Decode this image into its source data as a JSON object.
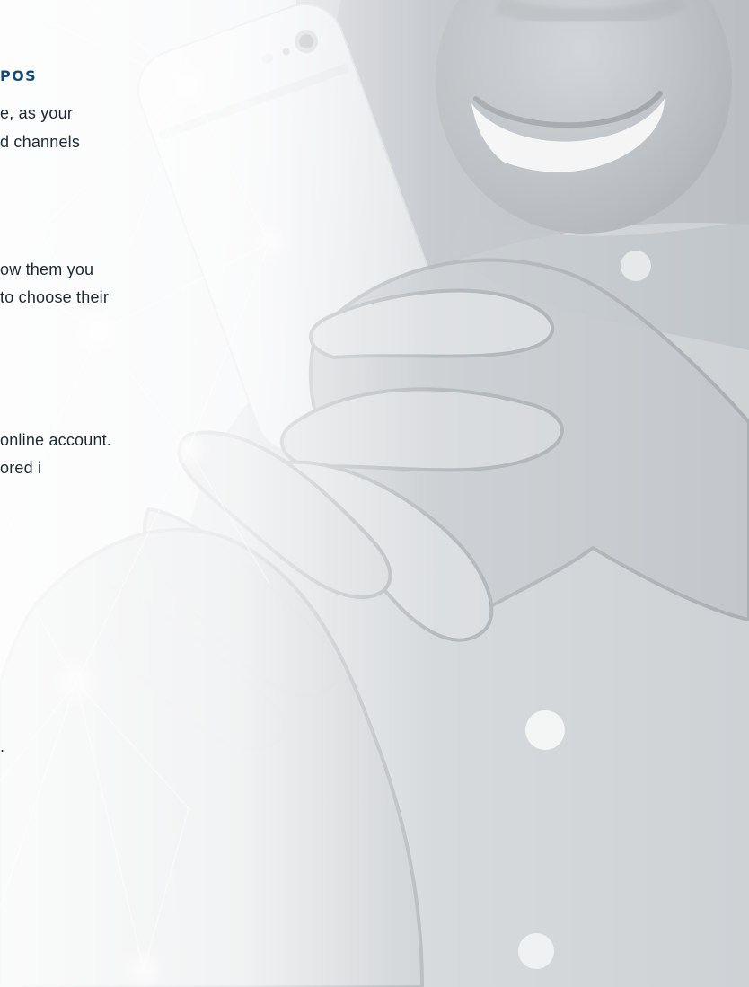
{
  "heading": "POS",
  "text_lines": [
    "e, as your",
    "d channels",
    "ow them you",
    "to choose their",
    "online account.",
    "ored i",
    "."
  ],
  "colors": {
    "heading": "#114a7b",
    "text": "#1f2833",
    "background": "#ebedf0"
  },
  "image": {
    "subject": "person holding smartphone"
  }
}
